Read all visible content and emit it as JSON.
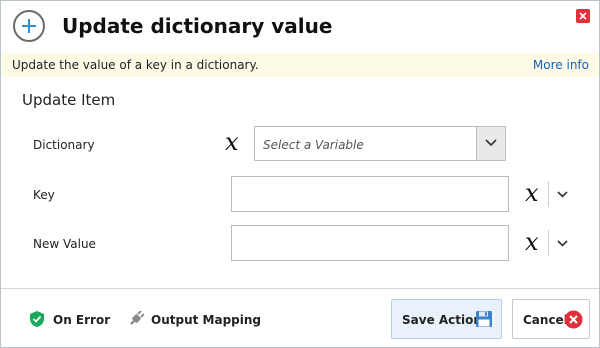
{
  "header": {
    "title": "Update dictionary value",
    "icon": "add-circle-icon",
    "close_icon": "close-icon"
  },
  "description": {
    "text": "Update the value of a key in a dictionary.",
    "more_info": "More info"
  },
  "section": {
    "title": "Update Item"
  },
  "fields": {
    "dictionary": {
      "label": "Dictionary",
      "placeholder": "Select a Variable",
      "variable_symbol": "x"
    },
    "key": {
      "label": "Key",
      "value": "",
      "variable_symbol": "x"
    },
    "new_value": {
      "label": "New Value",
      "value": "",
      "variable_symbol": "x"
    }
  },
  "footer": {
    "on_error": "On Error",
    "output_mapping": "Output Mapping",
    "save_action": "Save Action",
    "cancel": "Cancel"
  },
  "colors": {
    "description_bg": "#fdfbe6",
    "link": "#1560bd",
    "close_red": "#e0313b",
    "save_bg": "#e9f2fb",
    "shield_green": "#1aa85b",
    "plus_blue": "#2f8fd8"
  }
}
